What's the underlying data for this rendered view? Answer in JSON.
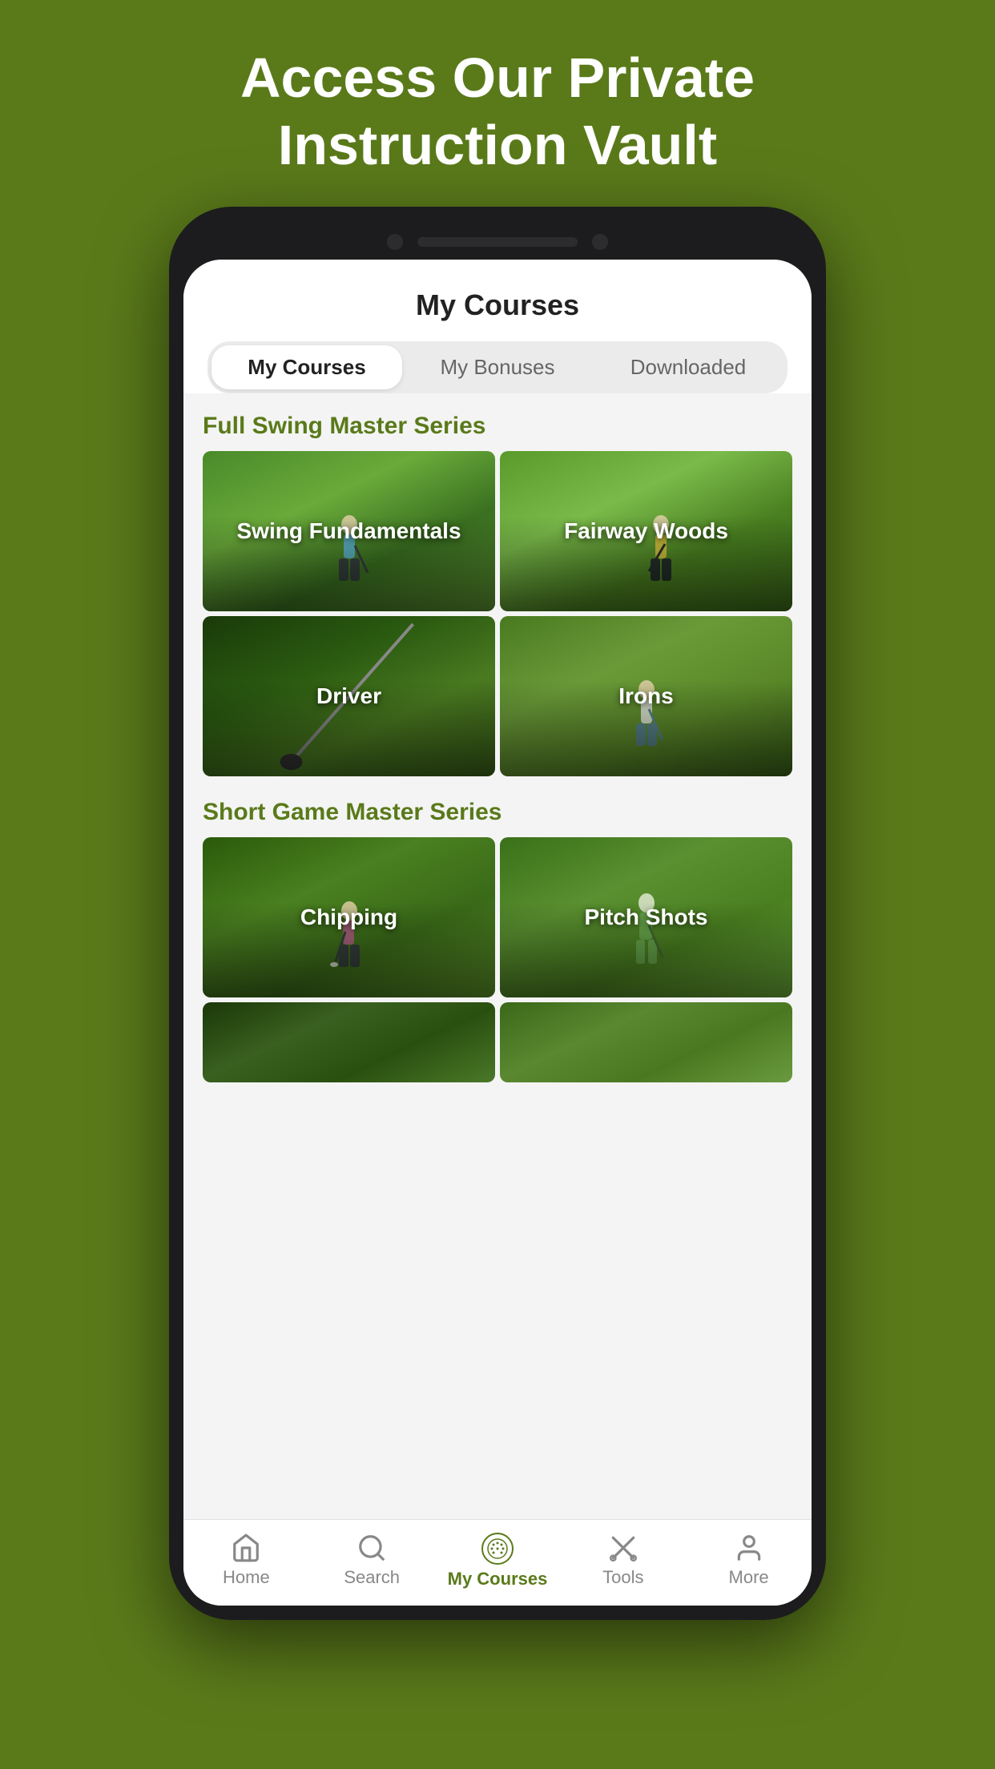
{
  "page": {
    "background_heading": "Access Our Private\nInstruction Vault",
    "colors": {
      "background": "#5a7a1a",
      "primary_green": "#5a7a1a",
      "white": "#ffffff"
    }
  },
  "app": {
    "title": "My Courses",
    "tabs": [
      {
        "id": "my-courses",
        "label": "My Courses",
        "active": true
      },
      {
        "id": "my-bonuses",
        "label": "My Bonuses",
        "active": false
      },
      {
        "id": "downloaded",
        "label": "Downloaded",
        "active": false
      }
    ],
    "sections": [
      {
        "id": "full-swing",
        "title": "Full Swing Master Series",
        "courses": [
          {
            "id": "swing-fundamentals",
            "label": "Swing Fundamentals",
            "bg": "swing-fund"
          },
          {
            "id": "fairway-woods",
            "label": "Fairway Woods",
            "bg": "fairway-woods"
          },
          {
            "id": "driver",
            "label": "Driver",
            "bg": "driver"
          },
          {
            "id": "irons",
            "label": "Irons",
            "bg": "irons"
          }
        ]
      },
      {
        "id": "short-game",
        "title": "Short Game Master Series",
        "courses": [
          {
            "id": "chipping",
            "label": "Chipping",
            "bg": "chipping"
          },
          {
            "id": "pitch-shots",
            "label": "Pitch Shots",
            "bg": "pitch-shots"
          },
          {
            "id": "partial-1",
            "label": "",
            "bg": "partial-1"
          },
          {
            "id": "partial-2",
            "label": "",
            "bg": "partial-2"
          }
        ]
      }
    ],
    "nav": [
      {
        "id": "home",
        "label": "Home",
        "icon": "home",
        "active": false
      },
      {
        "id": "search",
        "label": "Search",
        "icon": "search",
        "active": false
      },
      {
        "id": "my-courses",
        "label": "My Courses",
        "icon": "golf-ball",
        "active": true
      },
      {
        "id": "tools",
        "label": "Tools",
        "icon": "tools",
        "active": false
      },
      {
        "id": "more",
        "label": "More",
        "icon": "person",
        "active": false
      }
    ]
  }
}
